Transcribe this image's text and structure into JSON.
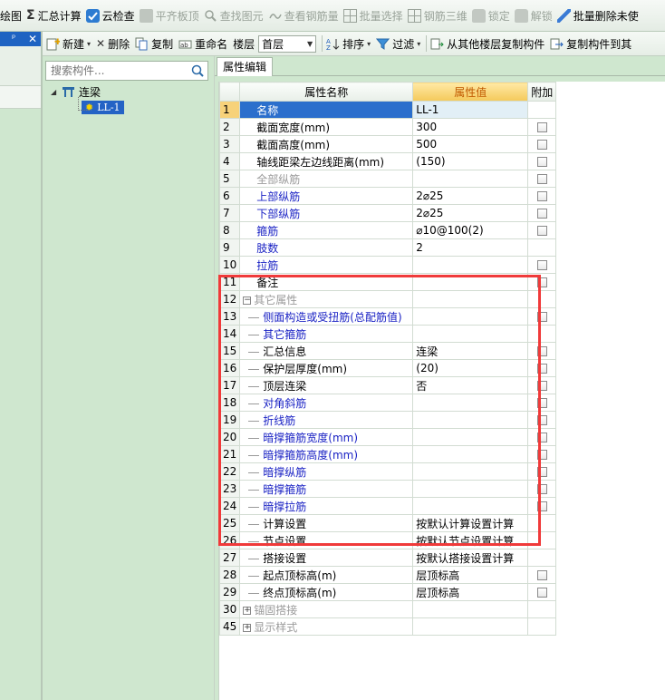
{
  "toolbar_top": {
    "items": [
      {
        "label": "绘图",
        "icon": "draw-icon",
        "disabled": false
      },
      {
        "label": "汇总计算",
        "icon": "sigma-icon",
        "disabled": false
      },
      {
        "label": "云检查",
        "icon": "cloud-check-icon",
        "disabled": false
      },
      {
        "label": "平齐板顶",
        "icon": "align-slab-icon",
        "disabled": true
      },
      {
        "label": "查找图元",
        "icon": "find-element-icon",
        "disabled": true
      },
      {
        "label": "查看钢筋量",
        "icon": "view-rebar-icon",
        "disabled": true
      },
      {
        "label": "批量选择",
        "icon": "batch-select-icon",
        "disabled": true
      },
      {
        "label": "钢筋三维",
        "icon": "rebar-3d-icon",
        "disabled": true
      },
      {
        "label": "锁定",
        "icon": "lock-icon",
        "disabled": true
      },
      {
        "label": "解锁",
        "icon": "unlock-icon",
        "disabled": true
      },
      {
        "label": "批量删除未使",
        "icon": "batch-delete-icon",
        "disabled": false
      }
    ]
  },
  "left_panel": {
    "pin_glyph": "ᵖ",
    "close_glyph": "✕"
  },
  "toolbar_second": {
    "new_label": "新建",
    "delete_label": "删除",
    "copy_label": "复制",
    "rename_label": "重命名",
    "floor_label": "楼层",
    "floor_value": "首层",
    "sort_label": "排序",
    "filter_label": "过滤",
    "copy_from_floor_label": "从其他楼层复制构件",
    "copy_to_label": "复制构件到其"
  },
  "search": {
    "placeholder": "搜索构件..."
  },
  "tree": {
    "root_label": "连梁",
    "child_label": "LL-1"
  },
  "tab": {
    "label": "属性编辑"
  },
  "grid": {
    "headers": {
      "name": "属性名称",
      "value": "属性值",
      "extra": "附加"
    },
    "rows": [
      {
        "num": "1",
        "name": "名称",
        "value": "LL-1",
        "style": "cur",
        "check": false,
        "indent": false
      },
      {
        "num": "2",
        "name": "截面宽度(mm)",
        "value": "300",
        "style": "normal",
        "check": true,
        "indent": false
      },
      {
        "num": "3",
        "name": "截面高度(mm)",
        "value": "500",
        "style": "normal",
        "check": true,
        "indent": false
      },
      {
        "num": "4",
        "name": "轴线距梁左边线距离(mm)",
        "value": "(150)",
        "style": "normal",
        "check": true,
        "indent": false
      },
      {
        "num": "5",
        "name": "全部纵筋",
        "value": "",
        "style": "gray",
        "check": true,
        "indent": false
      },
      {
        "num": "6",
        "name": "上部纵筋",
        "value": "2⌀25",
        "style": "blue",
        "check": true,
        "indent": false
      },
      {
        "num": "7",
        "name": "下部纵筋",
        "value": "2⌀25",
        "style": "blue",
        "check": true,
        "indent": false
      },
      {
        "num": "8",
        "name": "箍筋",
        "value": "⌀10@100(2)",
        "style": "blue",
        "check": true,
        "indent": false
      },
      {
        "num": "9",
        "name": "肢数",
        "value": "2",
        "style": "blue",
        "check": false,
        "indent": false
      },
      {
        "num": "10",
        "name": "拉筋",
        "value": "",
        "style": "blue",
        "check": true,
        "indent": false
      },
      {
        "num": "11",
        "name": "备注",
        "value": "",
        "style": "normal",
        "check": true,
        "indent": false
      },
      {
        "num": "12",
        "name": "其它属性",
        "value": "",
        "style": "group-minus",
        "check": false,
        "indent": false
      },
      {
        "num": "13",
        "name": "侧面构造或受扭筋(总配筋值)",
        "value": "",
        "style": "blue",
        "check": true,
        "indent": true
      },
      {
        "num": "14",
        "name": "其它箍筋",
        "value": "",
        "style": "blue",
        "check": false,
        "indent": true
      },
      {
        "num": "15",
        "name": "汇总信息",
        "value": "连梁",
        "style": "normal",
        "check": true,
        "indent": true
      },
      {
        "num": "16",
        "name": "保护层厚度(mm)",
        "value": "(20)",
        "style": "normal",
        "check": true,
        "indent": true
      },
      {
        "num": "17",
        "name": "顶层连梁",
        "value": "否",
        "style": "normal",
        "check": true,
        "indent": true
      },
      {
        "num": "18",
        "name": "对角斜筋",
        "value": "",
        "style": "blue",
        "check": true,
        "indent": true
      },
      {
        "num": "19",
        "name": "折线筋",
        "value": "",
        "style": "blue",
        "check": true,
        "indent": true
      },
      {
        "num": "20",
        "name": "暗撑箍筋宽度(mm)",
        "value": "",
        "style": "blue",
        "check": true,
        "indent": true
      },
      {
        "num": "21",
        "name": "暗撑箍筋高度(mm)",
        "value": "",
        "style": "blue",
        "check": true,
        "indent": true
      },
      {
        "num": "22",
        "name": "暗撑纵筋",
        "value": "",
        "style": "blue",
        "check": true,
        "indent": true
      },
      {
        "num": "23",
        "name": "暗撑箍筋",
        "value": "",
        "style": "blue",
        "check": true,
        "indent": true
      },
      {
        "num": "24",
        "name": "暗撑拉筋",
        "value": "",
        "style": "blue",
        "check": true,
        "indent": true
      },
      {
        "num": "25",
        "name": "计算设置",
        "value": "按默认计算设置计算",
        "style": "normal",
        "check": false,
        "indent": true
      },
      {
        "num": "26",
        "name": "节点设置",
        "value": "按默认节点设置计算",
        "style": "normal",
        "check": false,
        "indent": true
      },
      {
        "num": "27",
        "name": "搭接设置",
        "value": "按默认搭接设置计算",
        "style": "normal",
        "check": false,
        "indent": true
      },
      {
        "num": "28",
        "name": "起点顶标高(m)",
        "value": "层顶标高",
        "style": "normal",
        "check": true,
        "indent": true
      },
      {
        "num": "29",
        "name": "终点顶标高(m)",
        "value": "层顶标高",
        "style": "normal",
        "check": true,
        "indent": true
      },
      {
        "num": "30",
        "name": "锚固搭接",
        "value": "",
        "style": "group-plus",
        "check": false,
        "indent": false
      },
      {
        "num": "45",
        "name": "显示样式",
        "value": "",
        "style": "group-plus",
        "check": false,
        "indent": false
      }
    ]
  },
  "colors": {
    "background": "#cfe7cf",
    "selection_blue": "#2b6fcc",
    "value_header": "#f4c95a",
    "highlight_box": "#f03a3a",
    "link_blue": "#1a22c4"
  }
}
